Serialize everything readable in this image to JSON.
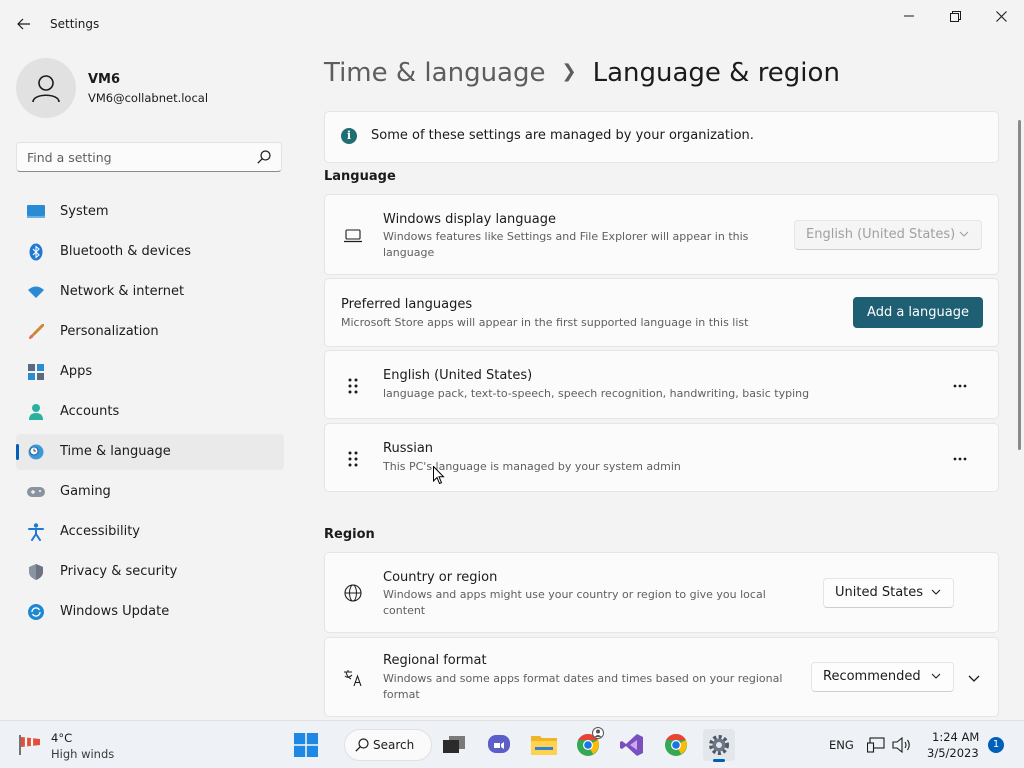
{
  "window": {
    "title": "Settings",
    "minimize_icon": "minimize-icon",
    "maximize_icon": "restore-icon",
    "close_icon": "close-icon"
  },
  "user": {
    "name": "VM6",
    "email": "VM6@collabnet.local"
  },
  "search": {
    "placeholder": "Find a setting"
  },
  "sidebar": {
    "items": [
      {
        "label": "System",
        "icon": "monitor-icon",
        "active": false
      },
      {
        "label": "Bluetooth & devices",
        "icon": "bluetooth-icon",
        "active": false
      },
      {
        "label": "Network & internet",
        "icon": "wifi-icon",
        "active": false
      },
      {
        "label": "Personalization",
        "icon": "brush-icon",
        "active": false
      },
      {
        "label": "Apps",
        "icon": "apps-icon",
        "active": false
      },
      {
        "label": "Accounts",
        "icon": "person-icon",
        "active": false
      },
      {
        "label": "Time & language",
        "icon": "clock-globe-icon",
        "active": true
      },
      {
        "label": "Gaming",
        "icon": "gamepad-icon",
        "active": false
      },
      {
        "label": "Accessibility",
        "icon": "accessibility-icon",
        "active": false
      },
      {
        "label": "Privacy & security",
        "icon": "shield-icon",
        "active": false
      },
      {
        "label": "Windows Update",
        "icon": "update-icon",
        "active": false
      }
    ]
  },
  "breadcrumb": {
    "parent": "Time & language",
    "current": "Language & region"
  },
  "notice": {
    "text": "Some of these settings are managed by your organization."
  },
  "language": {
    "section_title": "Language",
    "display": {
      "title": "Windows display language",
      "description": "Windows features like Settings and File Explorer will appear in this language",
      "value": "English (United States)"
    },
    "preferred": {
      "title": "Preferred languages",
      "description": "Microsoft Store apps will appear in the first supported language in this list",
      "button": "Add a language"
    },
    "languages": [
      {
        "name": "English (United States)",
        "detail": "language pack, text-to-speech, speech recognition, handwriting, basic typing"
      },
      {
        "name": "Russian",
        "detail": "This PC's language is managed by your system admin"
      }
    ]
  },
  "region": {
    "section_title": "Region",
    "country": {
      "title": "Country or region",
      "description": "Windows and apps might use your country or region to give you local content",
      "value": "United States"
    },
    "format": {
      "title": "Regional format",
      "description": "Windows and some apps format dates and times based on your regional format",
      "value": "Recommended"
    }
  },
  "taskbar": {
    "weather_temp": "4°C",
    "weather_desc": "High winds",
    "search_label": "Search",
    "lang": "ENG",
    "time": "1:24 AM",
    "date": "3/5/2023",
    "notification_count": "1"
  },
  "colors": {
    "accent": "#1f5f73",
    "nav_indicator": "#005fb8",
    "info": "#1f6e74"
  }
}
